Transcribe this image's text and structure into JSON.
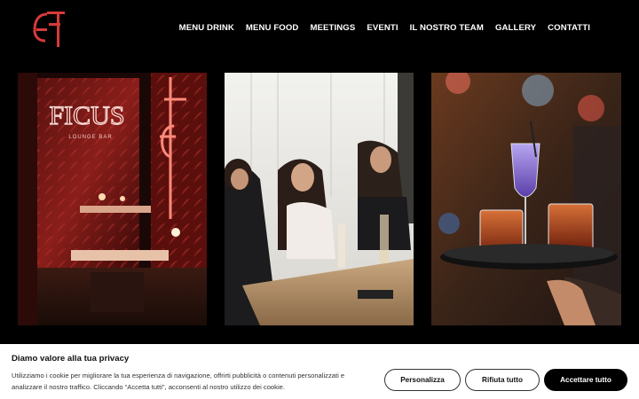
{
  "brand": {
    "logo_alt": "Ficus logo",
    "accent_color": "#d83a3a"
  },
  "nav": {
    "items": [
      {
        "label": "MENU DRINK"
      },
      {
        "label": "MENU FOOD"
      },
      {
        "label": "MEETINGS"
      },
      {
        "label": "EVENTI"
      },
      {
        "label": "IL NOSTRO TEAM"
      },
      {
        "label": "GALLERY"
      },
      {
        "label": "CONTATTI"
      }
    ]
  },
  "gallery": {
    "photo1": {
      "sign_main": "FICUS",
      "sign_sub": "LOUNGE BAR"
    }
  },
  "cookie_banner": {
    "title": "Diamo valore alla tua privacy",
    "text": "Utilizziamo i cookie per migliorare la tua esperienza di navigazione, offrirti pubblicità o contenuti personalizzati e analizzare il nostro traffico. Cliccando “Accetta tutti”, acconsenti al nostro utilizzo dei cookie.",
    "buttons": {
      "customize": "Personalizza",
      "reject": "Rifiuta tutto",
      "accept": "Accettare tutto"
    }
  }
}
